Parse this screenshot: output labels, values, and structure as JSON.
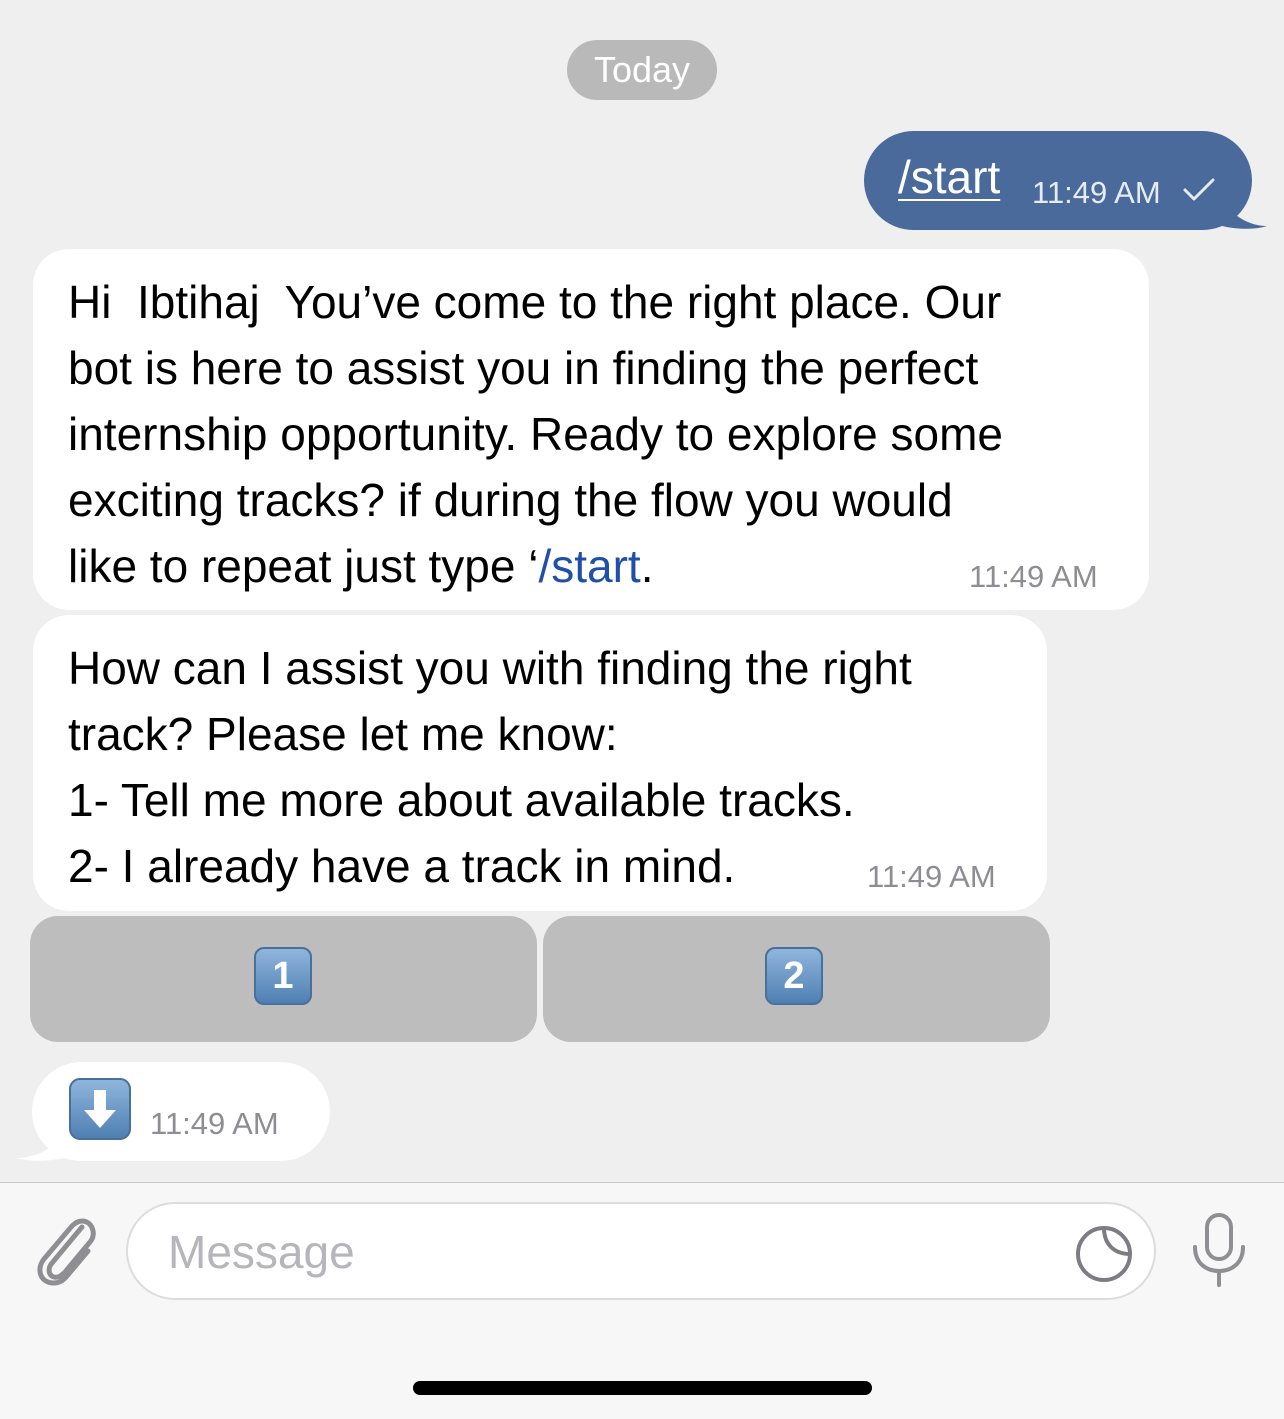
{
  "date_separator": "Today",
  "messages": {
    "outgoing_command": {
      "text": "/start",
      "time": "11:49 AM",
      "status": "sent"
    },
    "bot_welcome": {
      "lines": [
        "Hi  Ibtihaj  You’ve come to the right place. Our",
        "bot is here to assist you in finding the perfect",
        "internship opportunity. Ready to explore some",
        "exciting tracks? if during the flow you would"
      ],
      "last_line_prefix": "like to repeat just type ‘",
      "link_text": "/start",
      "last_line_suffix": ".",
      "time": "11:49 AM"
    },
    "bot_options": {
      "lines": [
        "How can I assist you with finding the right",
        "track? Please let me know:",
        "1- Tell me more about available tracks.",
        "2- I already have a track in mind."
      ],
      "time": "11:49 AM"
    },
    "bot_arrow": {
      "icon": "down-arrow-key-emoji",
      "time": "11:49 AM"
    }
  },
  "inline_keyboard": [
    {
      "label": "1",
      "icon": "keycap-1-emoji"
    },
    {
      "label": "2",
      "icon": "keycap-2-emoji"
    }
  ],
  "composer": {
    "placeholder": "Message",
    "icons": [
      "paperclip-icon",
      "sticker-icon",
      "microphone-icon"
    ]
  },
  "colors": {
    "outgoing_bubble": "#496a9b",
    "incoming_bubble": "#ffffff",
    "chat_background": "#efefef",
    "link": "#1f4fa6",
    "keyboard_button": "#bdbdbd",
    "date_pill": "#b9b9b9"
  }
}
